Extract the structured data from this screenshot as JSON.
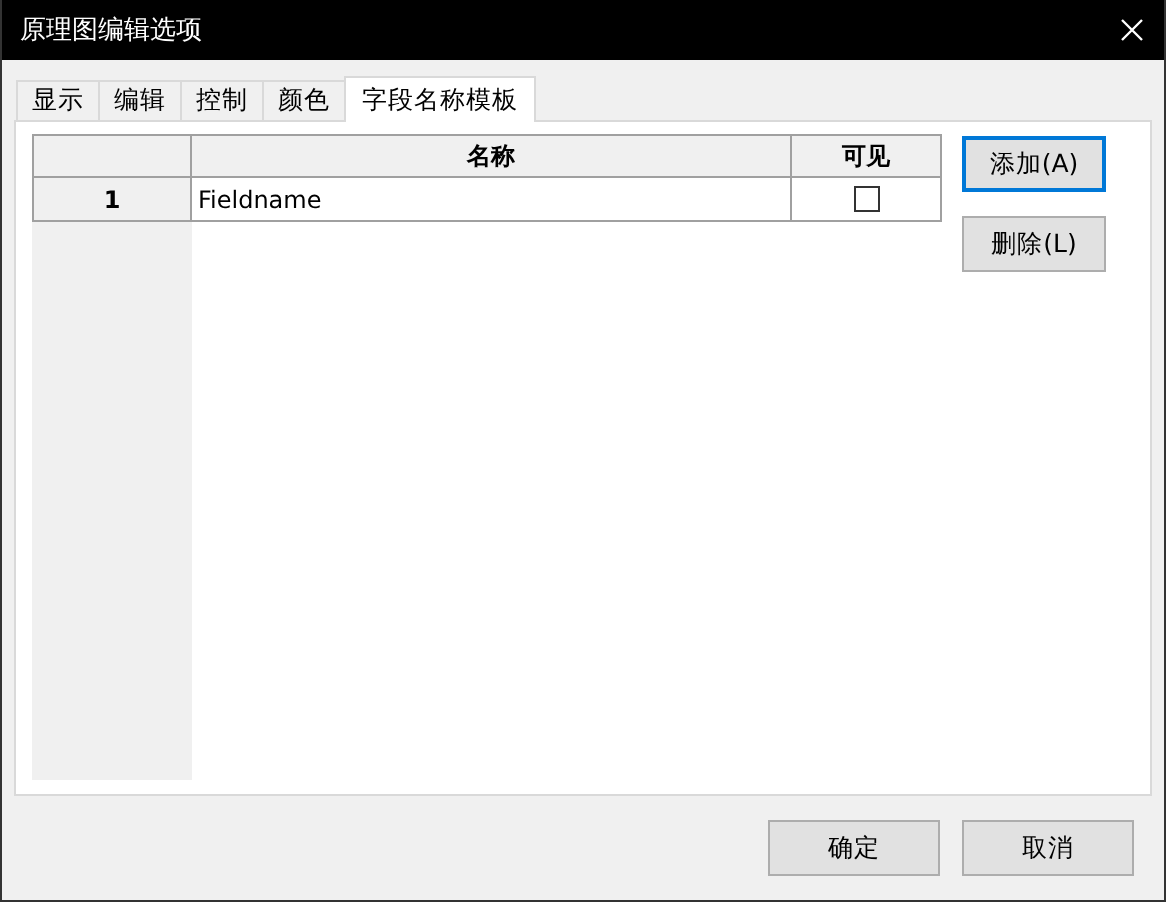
{
  "window": {
    "title": "原理图编辑选项"
  },
  "tabs": [
    {
      "label": "显示",
      "selected": false
    },
    {
      "label": "编辑",
      "selected": false
    },
    {
      "label": "控制",
      "selected": false
    },
    {
      "label": "颜色",
      "selected": false
    },
    {
      "label": "字段名称模板",
      "selected": true
    }
  ],
  "table": {
    "columns": [
      "名称",
      "可见"
    ],
    "rows": [
      {
        "index": "1",
        "name": "Fieldname",
        "visible": false
      }
    ]
  },
  "side_buttons": [
    {
      "label": "添加(A)",
      "focused": true
    },
    {
      "label": "删除(L)",
      "focused": false
    }
  ],
  "footer_buttons": [
    "确定",
    "取消"
  ]
}
